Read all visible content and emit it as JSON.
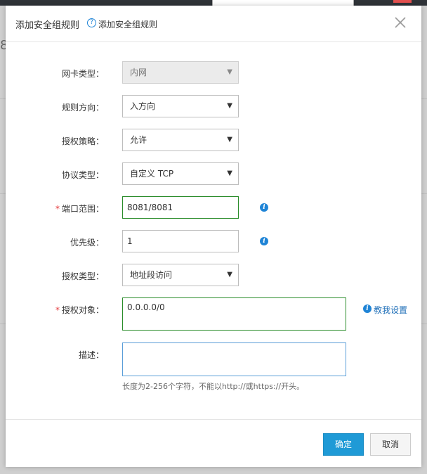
{
  "background": {
    "number_fragment": "8"
  },
  "dialog": {
    "title": "添加安全组规则",
    "help_symbol": "?",
    "subtitle": "添加安全组规则"
  },
  "form": {
    "nic_type": {
      "label": "网卡类型：",
      "value": "内网",
      "disabled": true
    },
    "direction": {
      "label": "规则方向：",
      "value": "入方向"
    },
    "policy": {
      "label": "授权策略：",
      "value": "允许"
    },
    "protocol": {
      "label": "协议类型：",
      "value": "自定义 TCP"
    },
    "port_range": {
      "label": "端口范围：",
      "required": "*",
      "value": "8081/8081"
    },
    "priority": {
      "label": "优先级：",
      "value": "1"
    },
    "auth_type": {
      "label": "授权类型：",
      "value": "地址段访问"
    },
    "auth_object": {
      "label": "授权对象：",
      "required": "*",
      "value": "0.0.0.0/0",
      "help_link": "教我设置"
    },
    "description": {
      "label": "描述：",
      "value": "",
      "hint": "长度为2-256个字符，不能以http://或https://开头。"
    }
  },
  "buttons": {
    "confirm": "确定",
    "cancel": "取消"
  },
  "icons": {
    "info": "info-icon",
    "close": "close-icon",
    "dropdown": "chevron-down-icon"
  },
  "colors": {
    "primary": "#1f9ad6",
    "valid_border": "#2a8c2a",
    "required_star": "#e4393c",
    "link": "#1f6fb8"
  }
}
